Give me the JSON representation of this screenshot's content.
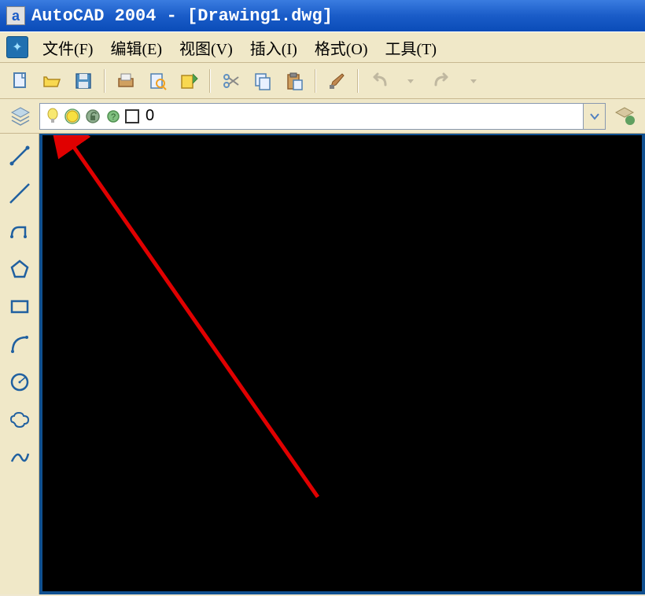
{
  "title_bar": {
    "app_name": "AutoCAD 2004",
    "separator": " - ",
    "document": "[Drawing1.dwg]",
    "icon_letter": "a"
  },
  "menu": {
    "file": "文件(F)",
    "edit": "编辑(E)",
    "view": "视图(V)",
    "insert": "插入(I)",
    "format": "格式(O)",
    "tools": "工具(T)"
  },
  "layer": {
    "current_name": "0"
  },
  "colors": {
    "titlebar_blue": "#1a5cc8",
    "toolbar_bg": "#f0e8c8",
    "canvas_bg": "#000000",
    "annotation_red": "#e00000"
  }
}
